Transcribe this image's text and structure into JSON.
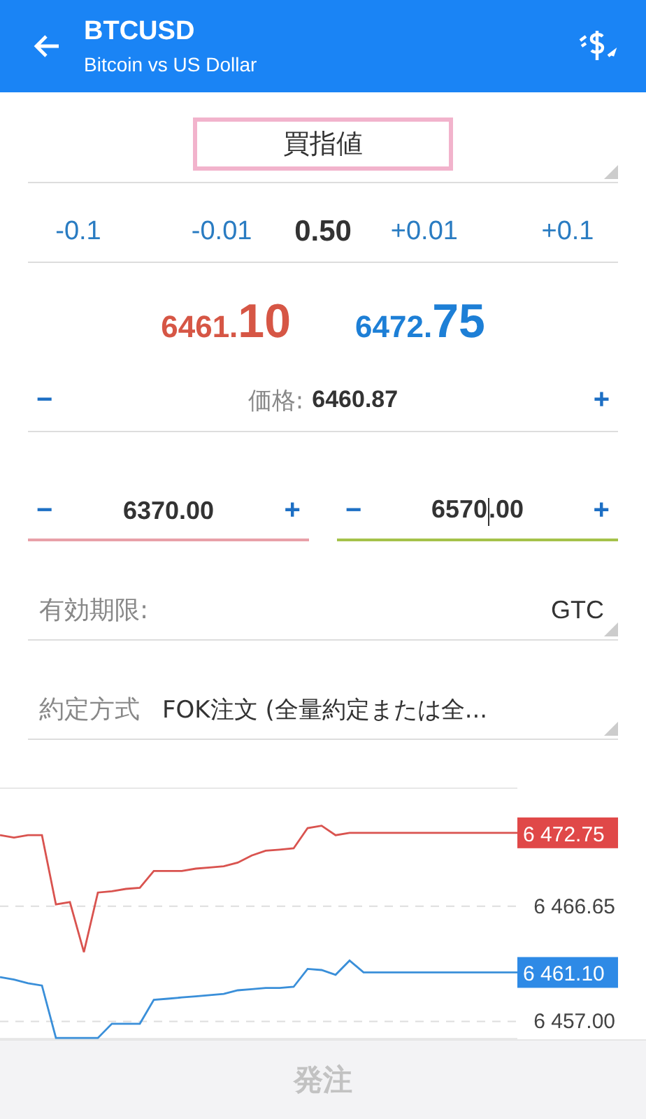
{
  "header": {
    "title": "BTCUSD",
    "subtitle": "Bitcoin vs US Dollar"
  },
  "order_type": {
    "value": "買指値"
  },
  "volume": {
    "steps": [
      "-0.1",
      "-0.01"
    ],
    "value": "0.50",
    "steps_up": [
      "+0.01",
      "+0.1"
    ]
  },
  "quotes": {
    "bid": {
      "main": "6461.",
      "big": "10"
    },
    "ask": {
      "main": "6472.",
      "big": "75"
    }
  },
  "price": {
    "minus": "−",
    "label": "価格:",
    "value": "6460.87",
    "plus": "+"
  },
  "stops": [
    {
      "kind": "loss",
      "minus": "−",
      "value_parts": [
        "6370.00"
      ],
      "plus": "+",
      "focused": false
    },
    {
      "kind": "profit",
      "minus": "−",
      "value_parts": [
        "6570",
        ".00"
      ],
      "plus": "+",
      "focused": true
    }
  ],
  "expiration": {
    "label": "有効期限:",
    "value": "GTC"
  },
  "filling": {
    "label": "約定方式",
    "value": "FOK注文 (全量約定または全..."
  },
  "chart": {
    "chart_data": {
      "type": "line",
      "categories": [
        null,
        null,
        null,
        null,
        null,
        null,
        null,
        null,
        null,
        null,
        null,
        null,
        null,
        null,
        null,
        null,
        null,
        null,
        null,
        null,
        null,
        null,
        null,
        null,
        null,
        null,
        null,
        null,
        null,
        null,
        null,
        null,
        null,
        null,
        null,
        null,
        null,
        null
      ],
      "ylim": [
        6455.5,
        6476.6
      ],
      "yticks": [
        {
          "value": 6466.65,
          "label": "6 466.65"
        },
        {
          "value": 6457.0,
          "label": "6 457.00"
        }
      ],
      "series": [
        {
          "color": "#d9534f",
          "values": [
            6472.6,
            6472.4,
            6472.6,
            6472.6,
            6466.8,
            6467.0,
            6462.8,
            6467.8,
            6467.9,
            6468.1,
            6468.2,
            6469.6,
            6469.6,
            6469.6,
            6469.8,
            6469.9,
            6470.0,
            6470.3,
            6470.9,
            6471.3,
            6471.4,
            6471.5,
            6473.2,
            6473.4,
            6472.6,
            6472.8,
            6472.8,
            6472.8,
            6472.8,
            6472.8,
            6472.8,
            6472.8,
            6472.8,
            6472.8,
            6472.8,
            6472.8,
            6472.8,
            6472.8
          ]
        },
        {
          "color": "#3a8fd9",
          "values": [
            6460.7,
            6460.5,
            6460.2,
            6460.0,
            6455.6,
            6455.6,
            6455.6,
            6455.6,
            6456.8,
            6456.8,
            6456.8,
            6458.8,
            6458.9,
            6459.0,
            6459.1,
            6459.2,
            6459.3,
            6459.6,
            6459.7,
            6459.8,
            6459.8,
            6459.9,
            6461.4,
            6461.3,
            6460.9,
            6462.1,
            6461.1,
            6461.1,
            6461.1,
            6461.1,
            6461.1,
            6461.1,
            6461.1,
            6461.1,
            6461.1,
            6461.1,
            6461.1,
            6461.1
          ]
        }
      ]
    },
    "price_tags": [
      {
        "label": "6 472.75",
        "color": "#e04848"
      },
      {
        "label": "6 461.10",
        "color": "#2e8ae6"
      }
    ]
  },
  "submit": {
    "label": "発注",
    "disabled": true
  }
}
